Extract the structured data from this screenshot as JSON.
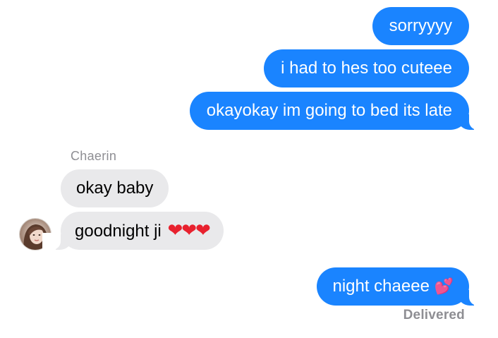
{
  "thread": {
    "sender_name": "Chaerin",
    "status": "Delivered",
    "colors": {
      "sent_bubble": "#1a84ff",
      "received_bubble": "#e9e9eb",
      "meta_text": "#8e8e93"
    },
    "messages": [
      {
        "direction": "sent",
        "text": "sorryyyy"
      },
      {
        "direction": "sent",
        "text": "i had to hes too cuteee"
      },
      {
        "direction": "sent",
        "text": "okayokay im going to bed its late"
      },
      {
        "direction": "received",
        "text": "okay baby"
      },
      {
        "direction": "received",
        "text": "goodnight ji",
        "emoji": "❤❤❤",
        "emoji_name": "red-heart-x3"
      },
      {
        "direction": "sent",
        "text": "night chaeee",
        "emoji": "💕",
        "emoji_name": "two-hearts"
      }
    ]
  }
}
